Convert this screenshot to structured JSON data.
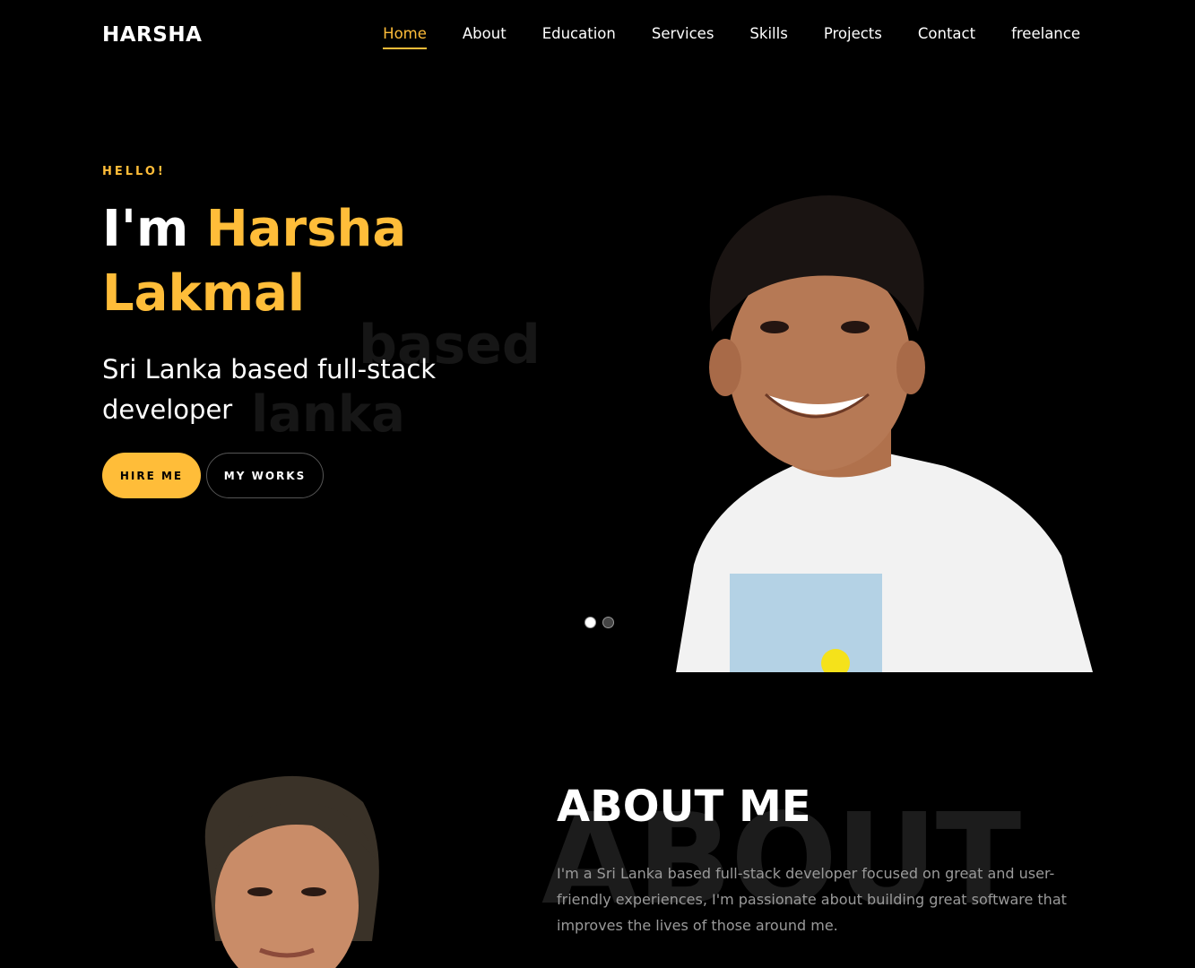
{
  "brand": "HARSHA",
  "nav": {
    "items": [
      "Home",
      "About",
      "Education",
      "Services",
      "Skills",
      "Projects",
      "Contact",
      "freelance"
    ],
    "active": "Home"
  },
  "hero": {
    "greeting": "HELLO!",
    "title_prefix": "I'm",
    "title_name_first": "Harsha",
    "title_name_last": "Lakmal",
    "subtitle": "Sri Lanka based full-stack developer",
    "ghost_word_1": "based",
    "ghost_word_2": "lanka",
    "hire_button": "HIRE ME",
    "works_button": "MY WORKS",
    "slides": 2,
    "active_slide": 1
  },
  "about": {
    "title": "ABOUT ME",
    "ghost_word": "ABOUT",
    "text": "I'm a Sri Lanka based full-stack developer focused on great and user-friendly experiences, I'm passionate about building great software that improves the lives of those around me."
  },
  "colors": {
    "accent": "#ffbd39",
    "background": "#000000"
  }
}
